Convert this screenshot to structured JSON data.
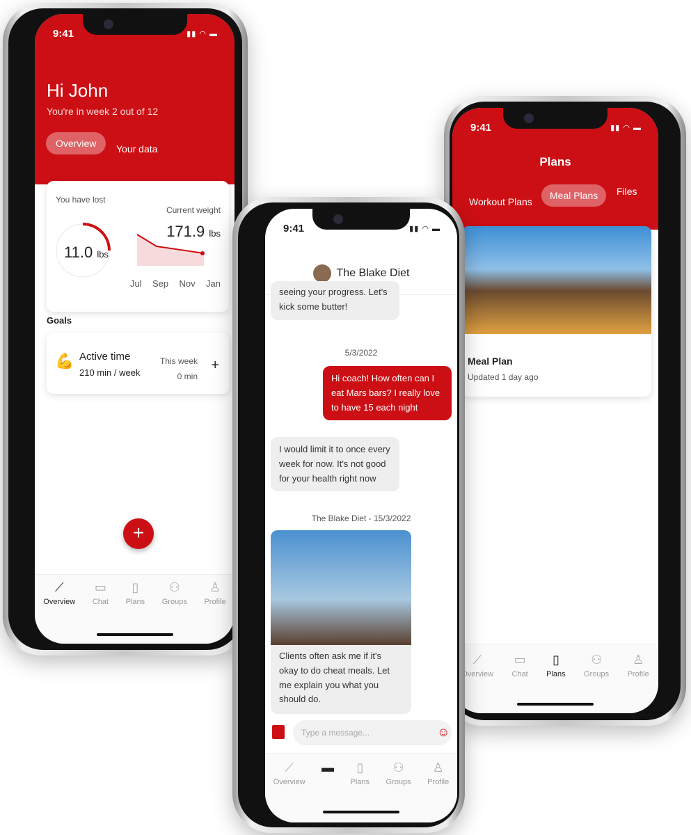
{
  "accent": "#cc0f14",
  "status_time": "9:41",
  "phone_overview": {
    "greeting": "Hi John",
    "subtitle": "You're in week 2 out of 12",
    "tabs": [
      {
        "label": "Overview",
        "active": true
      },
      {
        "label": "Your data",
        "active": false
      }
    ],
    "lost_label": "You have lost",
    "lost_value": "11.0",
    "lost_unit": "lbs",
    "current_label": "Current weight",
    "current_value": "171.9",
    "current_unit": "lbs",
    "months": [
      "Jul",
      "Sep",
      "Nov",
      "Jan"
    ],
    "goals_title": "Goals",
    "goal": {
      "icon": "flexed-biceps-icon",
      "title": "Active time",
      "target": "210 min / week",
      "period_label": "This week",
      "progress": "0 min"
    },
    "fab_icon": "plus-icon",
    "nav": [
      {
        "label": "Overview",
        "icon": "chart-line-icon",
        "active": true
      },
      {
        "label": "Chat",
        "icon": "chat-icon"
      },
      {
        "label": "Plans",
        "icon": "document-icon"
      },
      {
        "label": "Groups",
        "icon": "users-icon"
      },
      {
        "label": "Profile",
        "icon": "user-icon"
      }
    ]
  },
  "phone_chat": {
    "title": "The Blake Diet",
    "messages": [
      {
        "from": "coach",
        "text": "seeing your progress. Let's kick some butter!"
      },
      {
        "type": "date",
        "text": "5/3/2022"
      },
      {
        "from": "me",
        "text": "Hi coach! How often can I eat Mars bars? I really love to have 15 each night"
      },
      {
        "from": "coach",
        "text": "I would limit it to once every week for now. It's not good for your health right now"
      },
      {
        "type": "date",
        "text": "The Blake Diet - 15/3/2022"
      },
      {
        "from": "coach",
        "text": "Clients often ask me if it's okay to do cheat meals. Let me explain you what you should do.",
        "image": true
      }
    ],
    "input_placeholder": "Type a message...",
    "nav": [
      {
        "label": "Overview"
      },
      {
        "label": ""
      },
      {
        "label": "Plans"
      },
      {
        "label": "Groups"
      },
      {
        "label": "Profile"
      }
    ]
  },
  "phone_plans": {
    "title": "Plans",
    "tabs": [
      {
        "label": "Workout Plans"
      },
      {
        "label": "Meal Plans",
        "active": true
      },
      {
        "label": "Files"
      }
    ],
    "plan": {
      "title": "Meal Plan",
      "updated": "Updated 1 day ago"
    },
    "nav": [
      {
        "label": "Overview"
      },
      {
        "label": "Chat"
      },
      {
        "label": "Plans",
        "active": true
      },
      {
        "label": "Groups"
      },
      {
        "label": "Profile"
      }
    ]
  }
}
